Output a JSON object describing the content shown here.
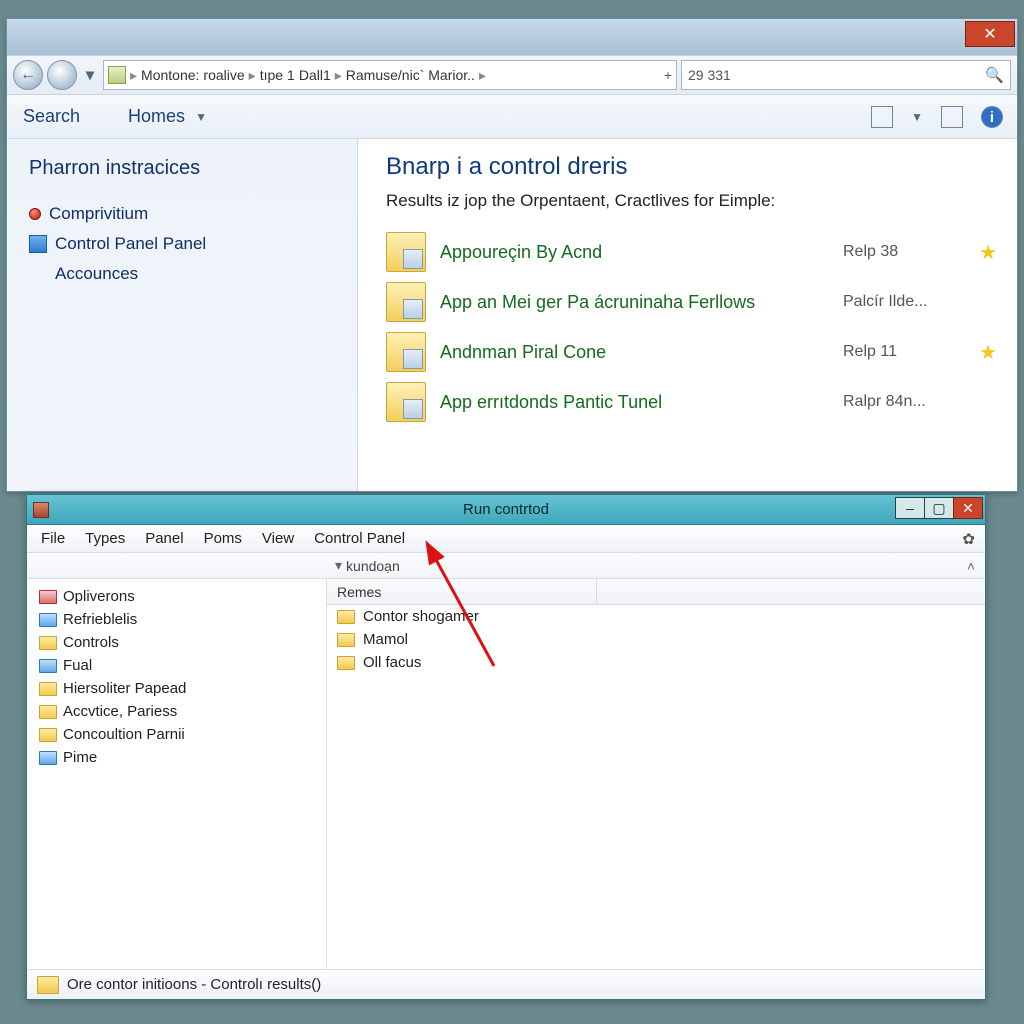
{
  "window1": {
    "titlebar": {
      "close_glyph": "✕"
    },
    "nav": {
      "back_glyph": "←",
      "forward_glyph": "",
      "recent_glyph": "▾"
    },
    "address": {
      "crumbs": [
        "Montone:",
        "roalive",
        "tıpe",
        "1",
        "Dall1",
        "Ramuse/nic` Marior..",
        ""
      ],
      "refresh_glyph": "+"
    },
    "search": {
      "value": "29 331",
      "mag_glyph": "🔍"
    },
    "menubar": {
      "items": [
        "Search",
        "Homes"
      ],
      "right_icons": {
        "icon1": "⧉",
        "dd": "▼",
        "icon2": "⎘",
        "info": "i"
      }
    },
    "sidebar": {
      "header": "Pharron instracices",
      "items": [
        {
          "label": "Comprivitium",
          "kind": "red"
        },
        {
          "label": "Control Panel Panel",
          "kind": "cp"
        },
        {
          "label": "Accounces",
          "kind": "none"
        }
      ]
    },
    "main": {
      "title": "Bnarp i a control dreris",
      "subtitle": "Results iz jop the Orpentaent, Cractlives for Eimple:",
      "results": [
        {
          "name": "Appoureçin By Acnd",
          "meta": "Relp 38",
          "star": true
        },
        {
          "name": "App an Mei ger Pa ácruninaha Ferllows",
          "meta": "Palcír Ilde...",
          "star": false
        },
        {
          "name": "Andnman Piral Cone",
          "meta": "Relp 11",
          "star": true
        },
        {
          "name": "App errıtdonds Pantic Tunel",
          "meta": "Ralpr 84n...",
          "star": false
        }
      ]
    }
  },
  "window2": {
    "title": "Run contrtod",
    "controls": {
      "min": "–",
      "max": "▢",
      "close": "✕"
    },
    "menu": [
      "File",
      "Types",
      "Panel",
      "Poms",
      "View",
      "Control Panel"
    ],
    "gear_glyph": "✿",
    "pathbar": {
      "disclosure": "▾",
      "label": "kundoạn",
      "right": "˄"
    },
    "tree": [
      {
        "label": "Opliverons",
        "icon": "sys"
      },
      {
        "label": "Refrieblelis",
        "icon": "blue"
      },
      {
        "label": "Controls",
        "icon": "fld"
      },
      {
        "label": "Fual",
        "icon": "blue"
      },
      {
        "label": "Hiersoliter Papead",
        "icon": "fld"
      },
      {
        "label": "Accvtice, Pariess",
        "icon": "fld"
      },
      {
        "label": "Concoultion Parnii",
        "icon": "fld"
      },
      {
        "label": "Pime",
        "icon": "blue"
      }
    ],
    "columns": {
      "name": "Remes"
    },
    "list": [
      {
        "label": "Contor shogamer"
      },
      {
        "label": "Mamol"
      },
      {
        "label": "Oll facus"
      }
    ],
    "status": "Ore contor initioons - Controlı results()"
  },
  "star_glyph": "★"
}
